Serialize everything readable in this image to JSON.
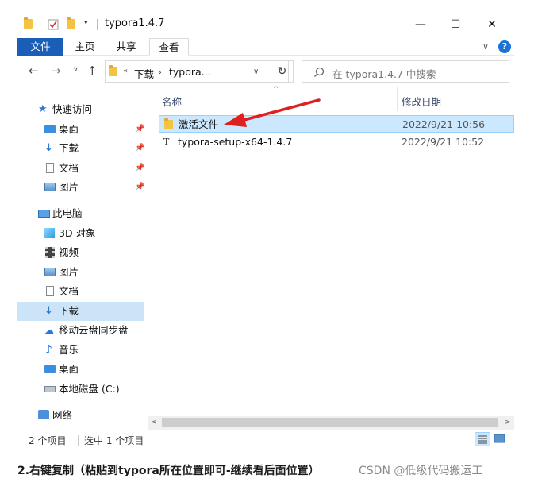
{
  "window": {
    "title": "typora1.4.7",
    "controls": {
      "minimize": "—",
      "maximize": "☐",
      "close": "✕"
    }
  },
  "ribbon": {
    "tabs": [
      "文件",
      "主页",
      "共享",
      "查看"
    ],
    "chevron": "∨",
    "help": "?"
  },
  "nav": {
    "back": "←",
    "forward": "→",
    "recent": "∨",
    "up": "↑",
    "path_prefix": "«",
    "path": [
      "下载",
      "typora..."
    ],
    "path_sep": "›",
    "dropdown": "∨",
    "refresh": "↻",
    "search_placeholder": "在 typora1.4.7 中搜索"
  },
  "sidebar": {
    "items": [
      {
        "label": "快速访问",
        "icon": "star-icon",
        "pinned": false
      },
      {
        "label": "桌面",
        "icon": "desktop-icon",
        "pinned": true
      },
      {
        "label": "下载",
        "icon": "download-icon",
        "pinned": true
      },
      {
        "label": "文档",
        "icon": "document-icon",
        "pinned": true
      },
      {
        "label": "图片",
        "icon": "picture-icon",
        "pinned": true
      },
      {
        "label": "此电脑",
        "icon": "computer-icon",
        "pinned": false
      },
      {
        "label": "3D 对象",
        "icon": "cube-icon",
        "pinned": false
      },
      {
        "label": "视频",
        "icon": "video-icon",
        "pinned": false
      },
      {
        "label": "图片",
        "icon": "picture-icon",
        "pinned": false
      },
      {
        "label": "文档",
        "icon": "document-icon",
        "pinned": false
      },
      {
        "label": "下载",
        "icon": "download-icon",
        "pinned": false,
        "selected": true
      },
      {
        "label": "移动云盘同步盘",
        "icon": "cloud-icon",
        "pinned": false
      },
      {
        "label": "音乐",
        "icon": "music-icon",
        "pinned": false
      },
      {
        "label": "桌面",
        "icon": "desktop-icon",
        "pinned": false
      },
      {
        "label": "本地磁盘 (C:)",
        "icon": "drive-icon",
        "pinned": false
      },
      {
        "label": "网络",
        "icon": "network-icon",
        "pinned": false
      }
    ],
    "pin_glyph": "📌"
  },
  "columns": {
    "name": "名称",
    "modified": "修改日期",
    "sort_glyph": "^"
  },
  "files": [
    {
      "name": "激活文件",
      "modified": "2022/9/21 10:56",
      "type": "folder",
      "selected": true
    },
    {
      "name": "typora-setup-x64-1.4.7",
      "modified": "2022/9/21 10:52",
      "type": "file"
    }
  ],
  "scroll": {
    "left": "<",
    "right": ">"
  },
  "status": {
    "count": "2 个项目",
    "selection": "选中 1 个项目"
  },
  "caption": "2.右键复制（粘贴到typora所在位置即可-继续看后面位置）",
  "watermark": "CSDN @低级代码搬运工",
  "colors": {
    "accent": "#1a5eb8",
    "selection": "#cce8ff",
    "arrow": "#e0201f"
  }
}
